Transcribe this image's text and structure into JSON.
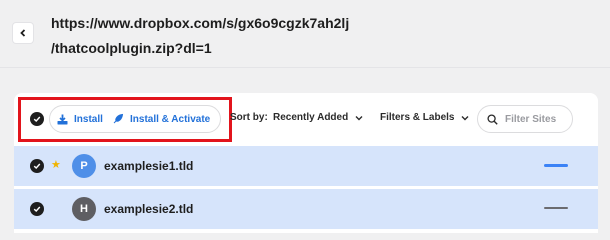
{
  "url": {
    "line1": "https://www.dropbox.com/s/gx6o9cgzk7ah2lj",
    "line2": "/thatcoolplugin.zip?dl=1"
  },
  "toolbar": {
    "install_label": "Install",
    "install_activate_label": "Install & Activate",
    "sort_label": "Sort by:",
    "sort_value": "Recently Added",
    "filters_label": "Filters & Labels",
    "search_placeholder": "Filter Sites"
  },
  "sites": [
    {
      "name": "examplesie1.tld",
      "initial": "P",
      "starred": true,
      "avatar_color": "#4f8fe8",
      "status_color": "#3b82f6"
    },
    {
      "name": "examplesie2.tld",
      "initial": "H",
      "starred": false,
      "avatar_color": "#5e5e62",
      "status_color": "#6b6b6f"
    }
  ],
  "colors": {
    "accent": "#2271d9",
    "highlight": "#e2141c",
    "row_selected": "#d6e4fb",
    "star": "#f0b400"
  },
  "icons": {
    "back": "chevron-left-icon",
    "install": "download-icon",
    "install_activate": "plugin-icon",
    "search": "search-icon",
    "dropdown": "chevron-down-icon",
    "star": "star-icon"
  }
}
